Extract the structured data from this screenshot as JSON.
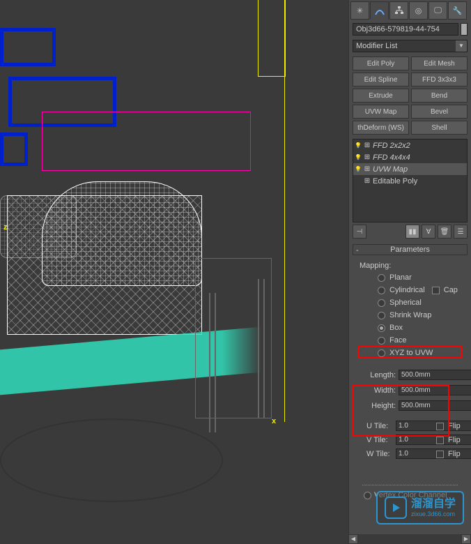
{
  "viewport": {
    "axis_labels": {
      "x": "x",
      "z": "z"
    }
  },
  "object_name": "Obj3d66-579819-44-754",
  "modifier_list_label": "Modifier List",
  "modifier_buttons": [
    "Edit Poly",
    "Edit Mesh",
    "Edit Spline",
    "FFD 3x3x3",
    "Extrude",
    "Bend",
    "UVW Map",
    "Bevel",
    "thDeform (WS)",
    "Shell"
  ],
  "modifier_stack": [
    {
      "expand": "⊞",
      "label": "FFD 2x2x2",
      "italic": true
    },
    {
      "expand": "⊞",
      "label": "FFD 4x4x4",
      "italic": true
    },
    {
      "expand": "⊞",
      "label": "UVW Map",
      "italic": true,
      "selected": true
    },
    {
      "expand": "",
      "label": "Editable Poly",
      "italic": false
    }
  ],
  "parameters": {
    "header": "Parameters",
    "mapping_label": "Mapping:",
    "mapping_options": {
      "planar": "Planar",
      "cylindrical": "Cylindrical",
      "cap": "Cap",
      "spherical": "Spherical",
      "shrink_wrap": "Shrink Wrap",
      "box": "Box",
      "face": "Face",
      "xyz_to_uvw": "XYZ to UVW"
    },
    "dimensions": {
      "length_label": "Length:",
      "length_value": "500.0mm",
      "width_label": "Width:",
      "width_value": "500.0mm",
      "height_label": "Height:",
      "height_value": "500.0mm"
    },
    "tile": {
      "u_label": "U Tile:",
      "u_value": "1.0",
      "v_label": "V Tile:",
      "v_value": "1.0",
      "w_label": "W Tile:",
      "w_value": "1.0",
      "flip_label": "Flip"
    },
    "channel": {
      "vertex_color": "Vertex Color Channel"
    }
  },
  "watermark": {
    "title": "溜溜自学",
    "url": "zixue.3d66.com"
  }
}
